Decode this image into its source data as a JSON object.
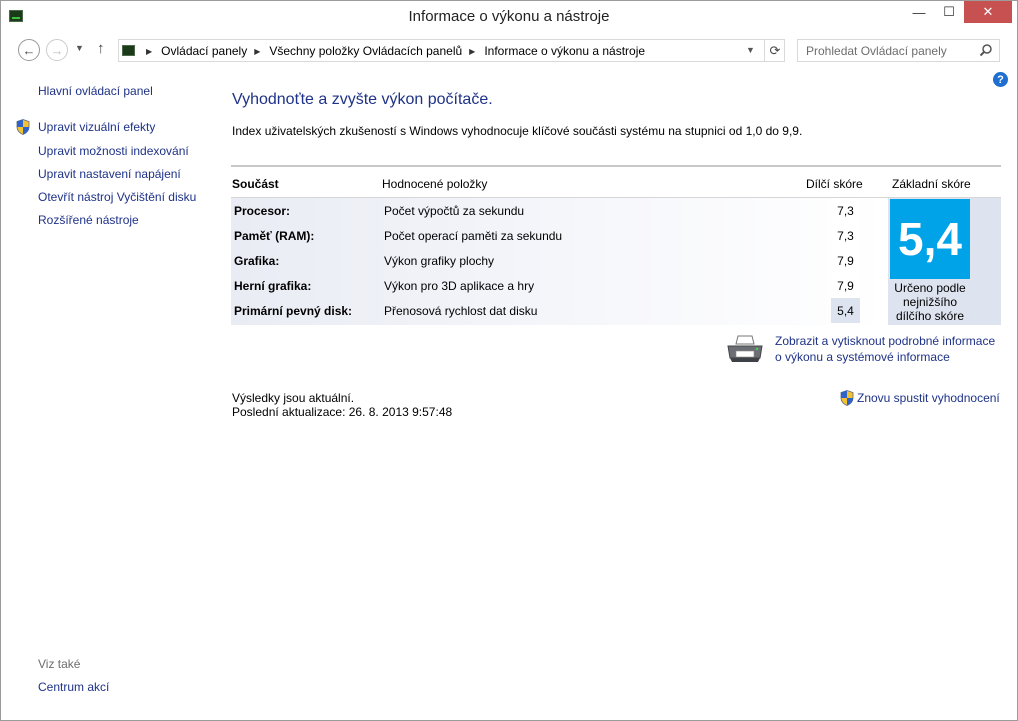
{
  "window": {
    "title": "Informace o výkonu a nástroje",
    "minimize": "—",
    "maximize": "☐",
    "close": "✕"
  },
  "nav": {
    "back": "←",
    "forward": "→",
    "recent": "▼",
    "up": "↑",
    "breadcrumbs": [
      "Ovládací panely",
      "Všechny položky Ovládacích panelů",
      "Informace o výkonu a nástroje"
    ],
    "crumb_separator": "▶",
    "address_dropdown": "▼",
    "refresh": "⟳",
    "search_placeholder": "Prohledat Ovládací panely"
  },
  "help": "?",
  "sidebar": {
    "home": "Hlavní ovládací panel",
    "tasks": [
      "Upravit vizuální efekty",
      "Upravit možnosti indexování",
      "Upravit nastavení napájení",
      "Otevřít nástroj Vyčištění disku",
      "Rozšířené nástroje"
    ],
    "see_also_label": "Viz také",
    "see_also": [
      "Centrum akcí"
    ]
  },
  "main": {
    "title": "Vyhodnoťte a zvyšte výkon počítače.",
    "description": "Index uživatelských zkušeností s Windows vyhodnocuje klíčové součásti systému na stupnici od 1,0 do 9,9.",
    "headers": {
      "component": "Součást",
      "rated": "Hodnocené položky",
      "subscore": "Dílčí skóre",
      "base": "Základní skóre"
    },
    "rows": [
      {
        "component": "Procesor:",
        "rated": "Počet výpočtů za sekundu",
        "subscore": "7,3"
      },
      {
        "component": "Paměť (RAM):",
        "rated": "Počet operací paměti za sekundu",
        "subscore": "7,3"
      },
      {
        "component": "Grafika:",
        "rated": "Výkon grafiky plochy",
        "subscore": "7,9"
      },
      {
        "component": "Herní grafika:",
        "rated": "Výkon pro 3D aplikace a hry",
        "subscore": "7,9"
      },
      {
        "component": "Primární pevný disk:",
        "rated": "Přenosová rychlost dat disku",
        "subscore": "5,4"
      }
    ],
    "base_score": "5,4",
    "base_note_lines": [
      "Určeno podle",
      "nejnižšího",
      "dílčího skóre"
    ],
    "print_link_lines": [
      "Zobrazit a vytisknout podrobné informace",
      "o výkonu a systémové informace"
    ],
    "status_current": "Výsledky jsou aktuální.",
    "status_updated": "Poslední aktualizace: 26. 8. 2013 9:57:48",
    "rerun": "Znovu spustit vyhodnocení"
  },
  "colors": {
    "link": "#1e3287",
    "base_score_bg": "#00a2e8",
    "close_button": "#c75050",
    "panel_bg": "#dde3ef"
  },
  "icons": [
    "control-panel-icon",
    "search-icon",
    "help-icon",
    "uac-shield-icon",
    "printer-icon"
  ]
}
